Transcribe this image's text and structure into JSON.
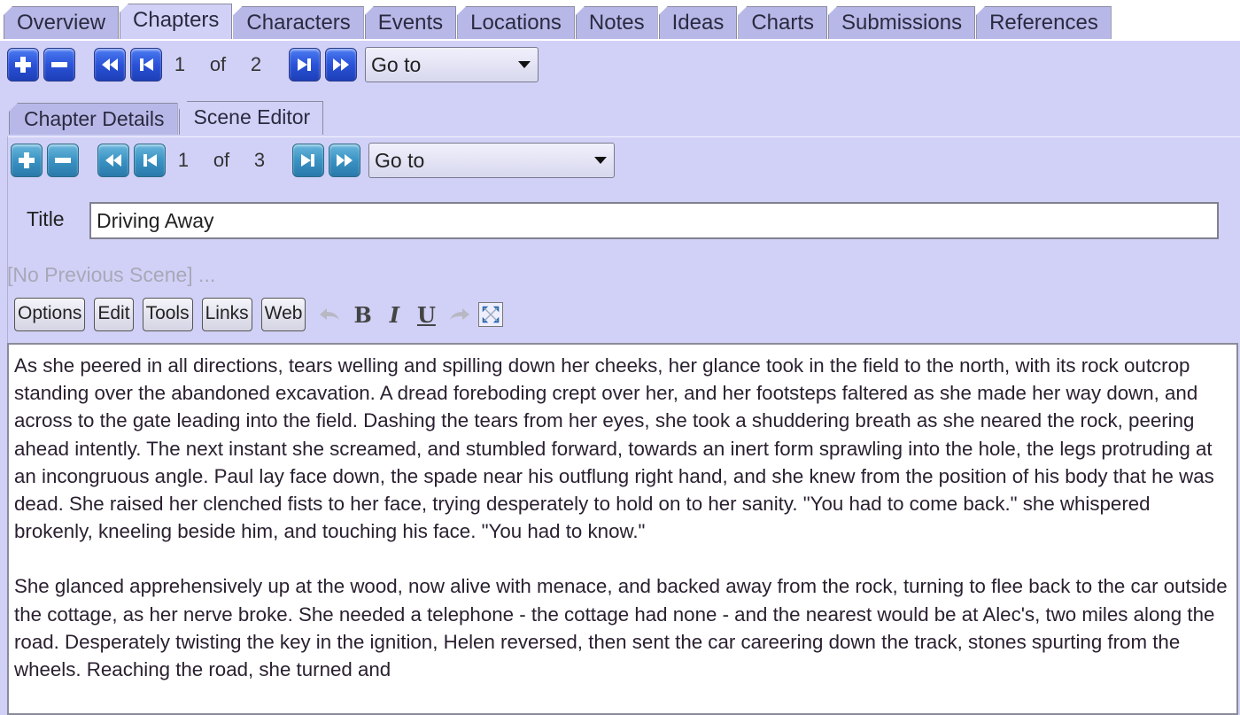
{
  "main_tabs": [
    {
      "label": "Overview",
      "active": false
    },
    {
      "label": "Chapters",
      "active": true
    },
    {
      "label": "Characters",
      "active": false
    },
    {
      "label": "Events",
      "active": false
    },
    {
      "label": "Locations",
      "active": false
    },
    {
      "label": "Notes",
      "active": false
    },
    {
      "label": "Ideas",
      "active": false
    },
    {
      "label": "Charts",
      "active": false
    },
    {
      "label": "Submissions",
      "active": false
    },
    {
      "label": "References",
      "active": false
    }
  ],
  "chapter_nav": {
    "current": "1",
    "of_label": "of",
    "total": "2",
    "goto_label": "Go to",
    "icons": [
      "add-icon",
      "remove-icon",
      "first-icon",
      "previous-icon",
      "next-icon",
      "last-icon"
    ]
  },
  "sub_tabs": [
    {
      "label": "Chapter Details",
      "active": false
    },
    {
      "label": "Scene Editor",
      "active": true
    }
  ],
  "scene_nav": {
    "current": "1",
    "of_label": "of",
    "total": "3",
    "goto_label": "Go to"
  },
  "scene": {
    "title_label": "Title",
    "title_value": "Driving Away",
    "previous_scene": "[No Previous Scene] ..."
  },
  "editor_toolbar": {
    "buttons": [
      "Options",
      "Edit",
      "Tools",
      "Links",
      "Web"
    ],
    "bold": "B",
    "italic": "I",
    "underline": "U"
  },
  "editor": {
    "paragraphs": [
      "As she peered in all directions, tears welling and spilling down her cheeks, her glance took in the field to the north, with its rock outcrop standing over the abandoned excavation. A dread foreboding crept over her, and her footsteps faltered as she made her way down, and across to the gate leading into the field. Dashing the tears from her eyes, she took a shuddering breath as she neared the rock, peering ahead intently. The next instant she screamed, and stumbled forward, towards an inert form sprawling into the hole, the legs protruding at an incongruous angle. Paul lay face down, the spade near his outflung right hand, and she knew from the position of his body that he was dead. She raised her clenched fists to her face, trying desperately to hold on to her sanity. \"You had to come back.\" she whispered brokenly, kneeling beside him, and touching his face. \"You had to know.\"",
      "She glanced apprehensively up at the wood, now alive with menace, and backed away from the rock, turning to flee back to the car outside the cottage, as her nerve broke. She needed a telephone - the cottage had none - and the nearest would be at Alec's, two miles along the road. Desperately twisting the key in the ignition, Helen reversed, then sent the car careering down the track, stones spurting from the wheels. Reaching the road, she turned and"
    ]
  }
}
